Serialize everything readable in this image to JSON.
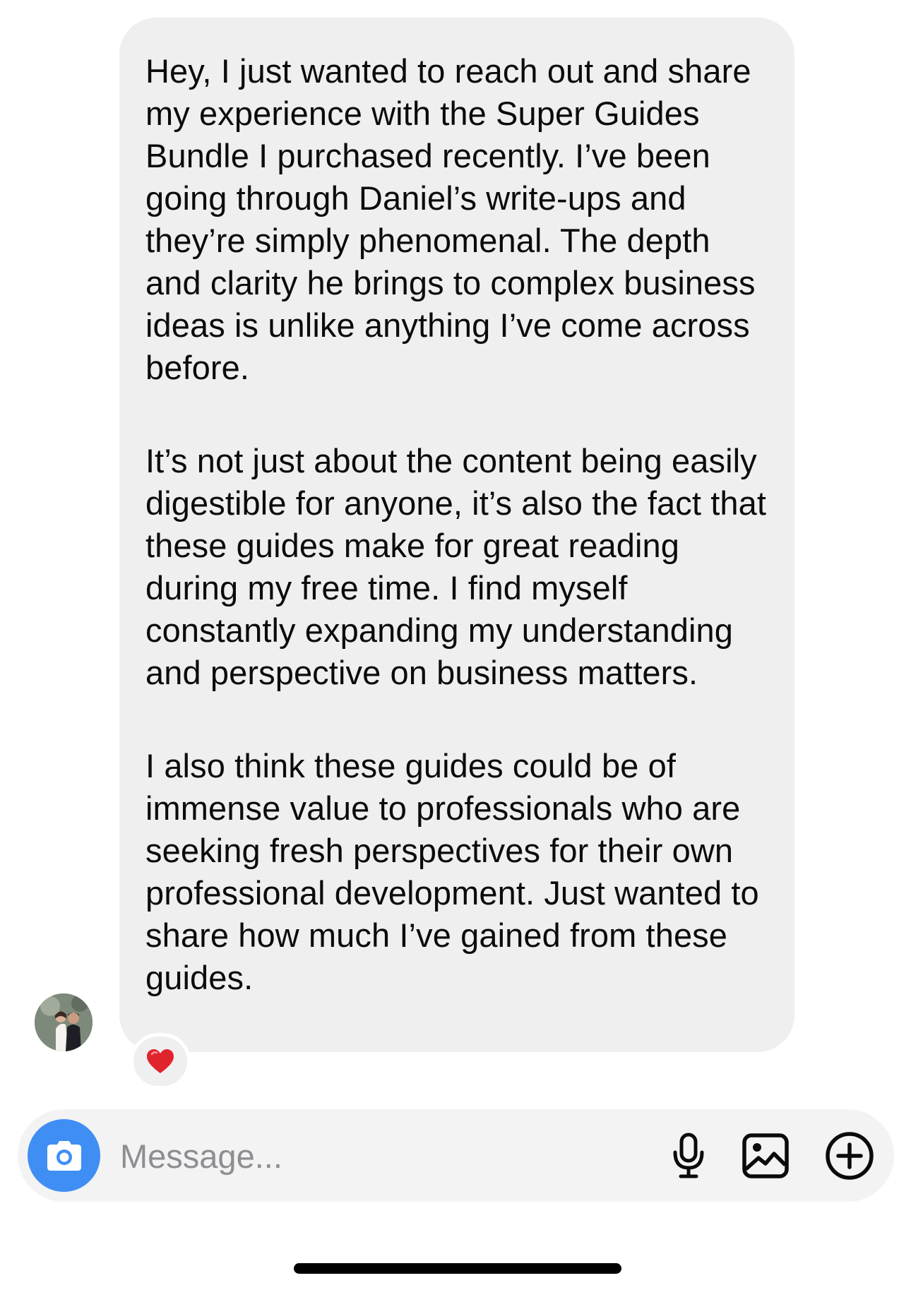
{
  "conversation": {
    "messages": [
      {
        "sender": "other",
        "paragraphs": [
          "Hey, I just wanted to reach out and share my experience with the Super Guides Bundle I purchased recently. I’ve been going through Daniel’s write-ups and they’re simply phenomenal. The depth and clarity he brings to complex business ideas is unlike anything I’ve come across before.",
          "It’s not just about the content being easily digestible for anyone, it’s also the fact that these guides make for great reading during my free time. I find myself constantly expanding my understanding and perspective on business matters.",
          "I also think these guides could be of immense value to professionals who are seeking fresh perspectives for their own professional development. Just wanted to share how much I’ve gained from these guides."
        ],
        "reaction": "heart-emoji"
      }
    ]
  },
  "composer": {
    "value": "",
    "placeholder": "Message...",
    "buttons": {
      "camera": "camera-icon",
      "voice": "microphone-icon",
      "gallery": "image-icon",
      "more": "plus-circle-icon"
    }
  },
  "colors": {
    "bubble_background": "#efeff0",
    "camera_button": "#3f8ef4",
    "composer_background": "#f3f3f4",
    "reaction_heart": "#e0242d"
  }
}
